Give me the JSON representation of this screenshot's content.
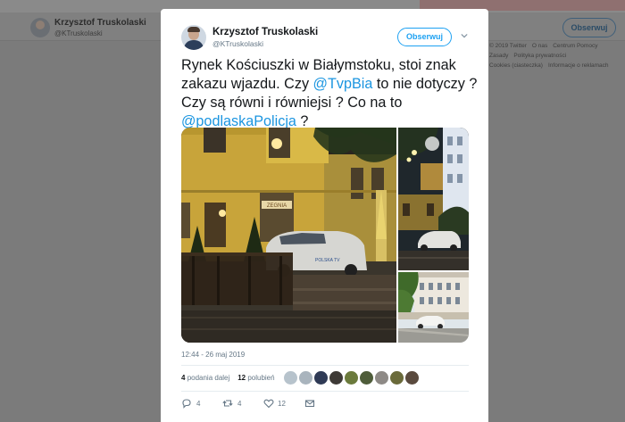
{
  "background": {
    "author_name": "Krzysztof Truskolaski",
    "author_handle": "@KTruskolaski",
    "follow_label": "Obserwuj",
    "footer_links": [
      "© 2019 Twitter",
      "O nas",
      "Centrum Pomocy",
      "Zasady",
      "Polityka prywatności",
      "Cookies (ciasteczka)",
      "Informacje o reklamach"
    ]
  },
  "tweet": {
    "author_name": "Krzysztof Truskolaski",
    "author_handle": "@KTruskolaski",
    "follow_label": "Obserwuj",
    "text_1": "Rynek Kościuszki w Białymstoku, stoi znak zakazu wjazdu. Czy ",
    "mention_1": "@TvpBia",
    "text_2": "  to nie dotyczy ? Czy są równi i równiejsi ? Co na to ",
    "mention_2": "@podlaskaPolicja",
    "text_3": " ?",
    "timestamp": "12:44 - 26 maj 2019",
    "retweet_count": "4",
    "retweet_label": "podania dalej",
    "like_count": "12",
    "like_label": "polubień",
    "actions": {
      "reply_count": "4",
      "retweet_count": "4",
      "like_count": "12"
    }
  },
  "icons": {
    "chevron": "chevron-down-icon",
    "reply": "reply-icon",
    "retweet": "retweet-icon",
    "like": "heart-icon",
    "dm": "envelope-icon"
  },
  "colors": {
    "accent": "#1da1f2",
    "mention": "#1b95e0",
    "secondary_text": "#657786"
  },
  "photo_labels": {
    "sign": "ZEGNIA",
    "car": "POLSKA TV"
  }
}
